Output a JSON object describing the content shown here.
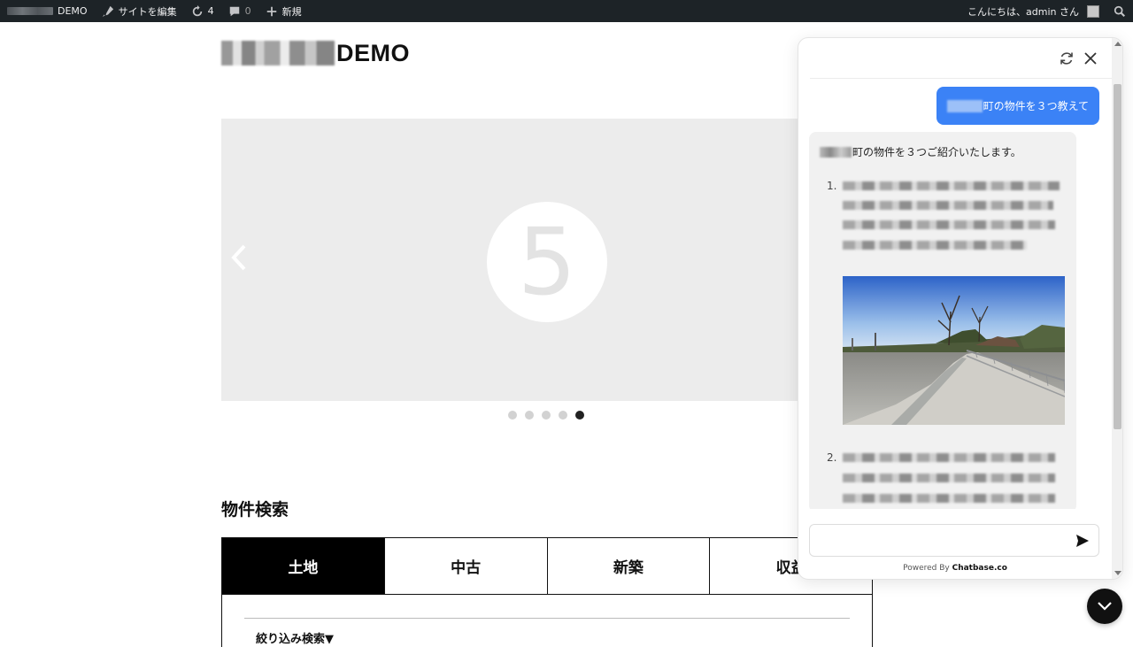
{
  "adminbar": {
    "site_suffix": "DEMO",
    "edit_site": "サイトを編集",
    "updates_count": "4",
    "comments_count": "0",
    "new_label": "新規",
    "greeting": "こんにちは、admin さん"
  },
  "site": {
    "logo_suffix": "DEMO"
  },
  "carousel": {
    "slide_number": "5",
    "slide_count": 5,
    "active_index": 4
  },
  "search": {
    "title": "物件検索",
    "tabs": [
      "土地",
      "中古",
      "新築",
      "収益"
    ],
    "active_tab": "土地",
    "filter_label": "絞り込み検索▼"
  },
  "chat": {
    "user_message_suffix": "町の物件を３つ教えて",
    "bot_intro_suffix": "町の物件を３つご紹介いたします。",
    "list_numbers": [
      "1.",
      "2."
    ],
    "input_placeholder": "",
    "powered_prefix": "Powered By ",
    "powered_brand": "Chatbase.co",
    "accent_color": "#3b82f6"
  }
}
